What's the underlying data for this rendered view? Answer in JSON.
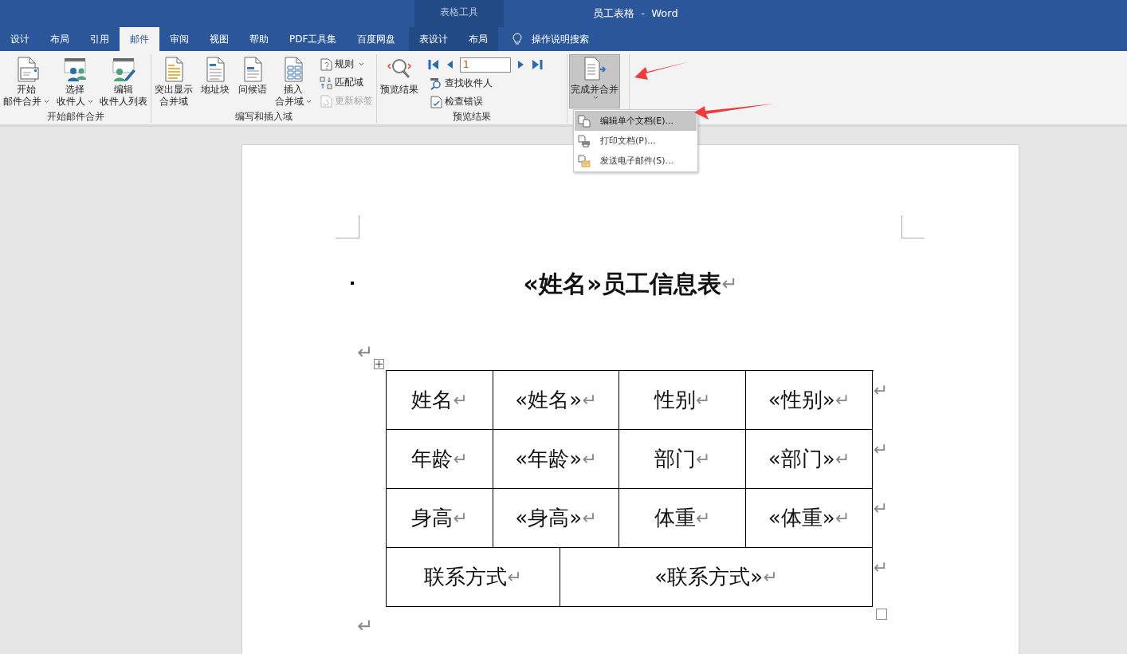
{
  "title_bar": {
    "context_label": "表格工具",
    "title": "员工表格  -  Word"
  },
  "tabs": [
    {
      "label": "设计",
      "kind": "normal",
      "selected": false
    },
    {
      "label": "布局",
      "kind": "normal",
      "selected": false
    },
    {
      "label": "引用",
      "kind": "normal",
      "selected": false
    },
    {
      "label": "邮件",
      "kind": "normal",
      "selected": true
    },
    {
      "label": "审阅",
      "kind": "normal",
      "selected": false
    },
    {
      "label": "视图",
      "kind": "normal",
      "selected": false
    },
    {
      "label": "帮助",
      "kind": "normal",
      "selected": false
    },
    {
      "label": "PDF工具集",
      "kind": "normal",
      "selected": false
    },
    {
      "label": "百度网盘",
      "kind": "normal",
      "selected": false
    },
    {
      "label": "表设计",
      "kind": "contextual",
      "selected": false
    },
    {
      "label": "布局",
      "kind": "contextual",
      "selected": false
    }
  ],
  "tell_me": {
    "label": "操作说明搜索"
  },
  "ribbon": {
    "groups": [
      {
        "label": "开始邮件合并",
        "controls": [
          {
            "kind": "large",
            "lines": [
              "开始",
              "邮件合并"
            ],
            "has_menu": true,
            "pressed": false
          },
          {
            "kind": "large",
            "lines": [
              "选择",
              "收件人"
            ],
            "has_menu": true,
            "pressed": false
          },
          {
            "kind": "large",
            "lines": [
              "编辑",
              "收件人列表"
            ],
            "has_menu": false,
            "pressed": false
          }
        ]
      },
      {
        "label": "编写和插入域",
        "controls": [
          {
            "kind": "large",
            "lines": [
              "突出显示",
              "合并域"
            ],
            "has_menu": false,
            "pressed": false
          },
          {
            "kind": "large",
            "lines": [
              "地址块"
            ],
            "has_menu": false,
            "pressed": false
          },
          {
            "kind": "large",
            "lines": [
              "问候语"
            ],
            "has_menu": false,
            "pressed": false
          },
          {
            "kind": "large",
            "lines": [
              "插入",
              "合并域"
            ],
            "has_menu": true,
            "pressed": false
          },
          {
            "kind": "stack",
            "items": [
              {
                "kind": "small",
                "label": "规则",
                "has_menu": true,
                "disabled": false
              },
              {
                "kind": "small",
                "label": "匹配域",
                "has_menu": false,
                "disabled": false
              },
              {
                "kind": "small",
                "label": "更新标签",
                "has_menu": false,
                "disabled": true
              }
            ]
          }
        ]
      },
      {
        "label": "预览结果",
        "controls": [
          {
            "kind": "large",
            "lines": [
              "预览结果"
            ],
            "has_menu": false,
            "pressed": false
          },
          {
            "kind": "stack",
            "items": [
              {
                "kind": "nav",
                "value": "1"
              },
              {
                "kind": "small",
                "label": "查找收件人",
                "has_menu": false,
                "disabled": false
              },
              {
                "kind": "small",
                "label": "检查错误",
                "has_menu": false,
                "disabled": false
              }
            ]
          }
        ]
      },
      {
        "controls": [
          {
            "kind": "large",
            "lines": [
              "完成并合并"
            ],
            "has_menu": true,
            "pressed": true
          }
        ]
      }
    ]
  },
  "menu": {
    "items": [
      {
        "label": "编辑单个文档(E)...",
        "selected": true
      },
      {
        "label": "打印文档(P)...",
        "selected": false
      },
      {
        "label": "发送电子邮件(S)...",
        "selected": false
      }
    ]
  },
  "document": {
    "blocks": [
      {
        "kind": "heading",
        "text": "«姓名»员工信息表",
        "mark": "↵"
      },
      {
        "kind": "empty",
        "mark": "↵"
      },
      {
        "kind": "table",
        "rows": [
          {
            "kind": "quad",
            "end_mark": "↵",
            "cells": [
              {
                "text": "姓名",
                "mark": "↵"
              },
              {
                "text": "«姓名»",
                "mark": "↵"
              },
              {
                "text": "性别",
                "mark": "↵"
              },
              {
                "text": "«性别»",
                "mark": "↵"
              }
            ]
          },
          {
            "kind": "quad",
            "end_mark": "↵",
            "cells": [
              {
                "text": "年龄",
                "mark": "↵"
              },
              {
                "text": "«年龄»",
                "mark": "↵"
              },
              {
                "text": "部门",
                "mark": "↵"
              },
              {
                "text": "«部门»",
                "mark": "↵"
              }
            ]
          },
          {
            "kind": "quad",
            "end_mark": "↵",
            "cells": [
              {
                "text": "身高",
                "mark": "↵"
              },
              {
                "text": "«身高»",
                "mark": "↵"
              },
              {
                "text": "体重",
                "mark": "↵"
              },
              {
                "text": "«体重»",
                "mark": "↵"
              }
            ]
          },
          {
            "kind": "pair",
            "end_mark": "↵",
            "cells": [
              {
                "text": "联系方式",
                "mark": "↵",
                "colspan": 2
              },
              {
                "text": "«联系方式»",
                "mark": "↵",
                "colspan": 2
              }
            ]
          }
        ]
      },
      {
        "kind": "empty",
        "mark": "↵"
      }
    ]
  }
}
